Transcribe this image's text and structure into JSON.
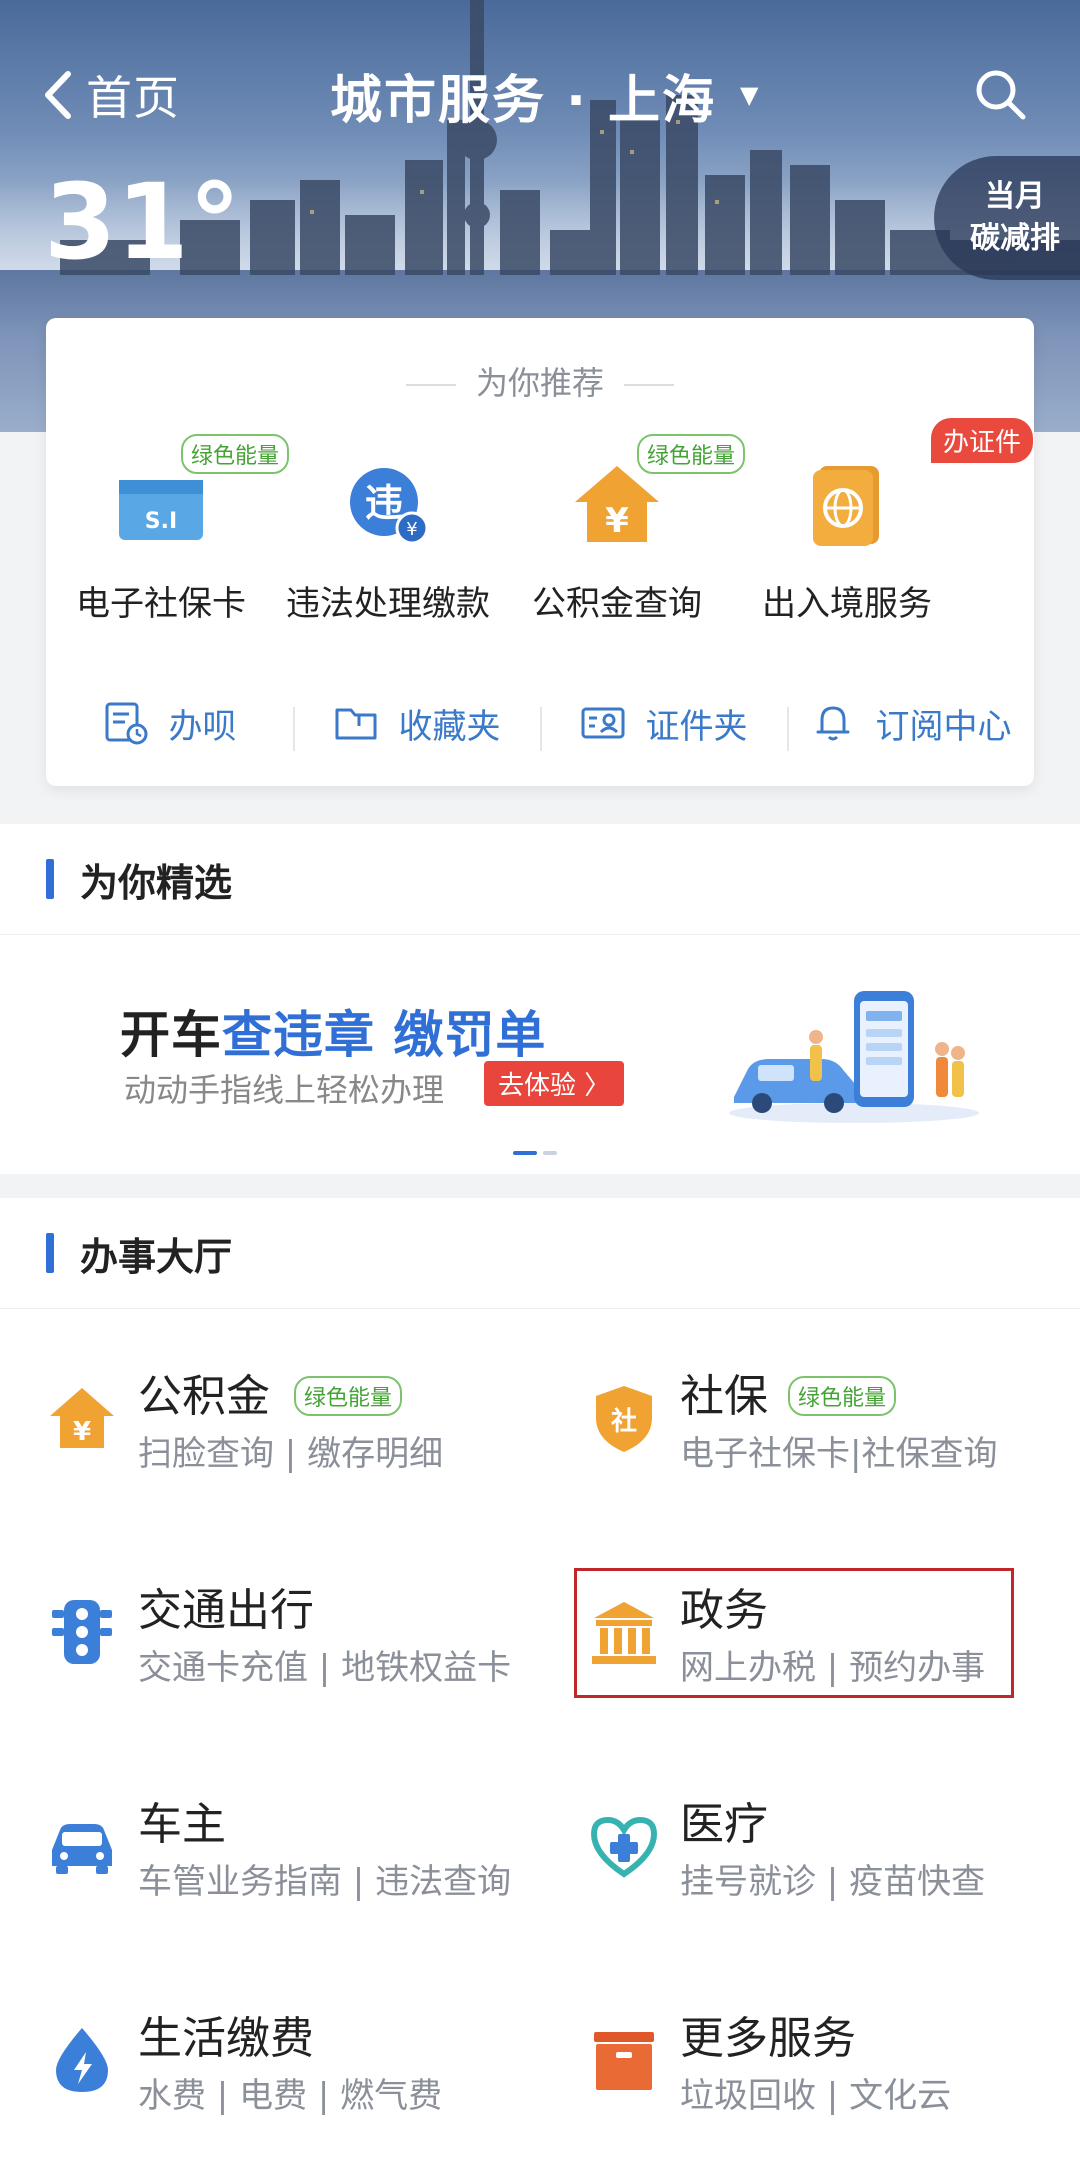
{
  "header": {
    "back_label": "首页",
    "title": "城市服务 · 上海",
    "title_caret": "▼",
    "temperature": "31°",
    "carbon_badge_line1": "当月",
    "carbon_badge_line2": "碳减排"
  },
  "recommend": {
    "title": "为你推荐",
    "items": [
      {
        "label": "电子社保卡",
        "tag": "绿色能量",
        "icon": "social-security-card-icon"
      },
      {
        "label": "违法处理缴款",
        "tag": "",
        "icon": "violation-payment-icon"
      },
      {
        "label": "公积金查询",
        "tag": "绿色能量",
        "icon": "housing-fund-icon"
      },
      {
        "label": "出入境服务",
        "tag": "办证件",
        "icon": "passport-icon"
      }
    ],
    "quick_links": [
      {
        "label": "办呗",
        "icon": "task-list-icon"
      },
      {
        "label": "收藏夹",
        "icon": "folder-icon"
      },
      {
        "label": "证件夹",
        "icon": "id-card-icon"
      },
      {
        "label": "订阅中心",
        "icon": "bell-icon"
      }
    ]
  },
  "featured": {
    "section_title": "为你精选",
    "banner": {
      "title_plain": "开车",
      "title_blue": "查违章 缴罚单",
      "subtitle": "动动手指线上轻松办理",
      "button": "去体验 〉"
    }
  },
  "hall": {
    "section_title": "办事大厅",
    "services": [
      {
        "name": "公积金",
        "tag": "绿色能量",
        "desc": "扫脸查询 | 缴存明细",
        "icon": "housing-fund-icon"
      },
      {
        "name": "社保",
        "tag": "绿色能量",
        "desc": "电子社保卡|社保查询",
        "icon": "social-security-shield-icon"
      },
      {
        "name": "交通出行",
        "tag": "",
        "desc": "交通卡充值 | 地铁权益卡",
        "icon": "traffic-light-icon"
      },
      {
        "name": "政务",
        "tag": "",
        "desc": "网上办税 | 预约办事",
        "icon": "government-building-icon"
      },
      {
        "name": "车主",
        "tag": "",
        "desc": "车管业务指南 | 违法查询",
        "icon": "car-icon"
      },
      {
        "name": "医疗",
        "tag": "",
        "desc": "挂号就诊 | 疫苗快查",
        "icon": "medical-heart-icon"
      },
      {
        "name": "生活缴费",
        "tag": "",
        "desc": "水费 | 电费 | 燃气费",
        "icon": "utility-drop-icon"
      },
      {
        "name": "更多服务",
        "tag": "",
        "desc": "垃圾回收 | 文化云",
        "icon": "more-services-box-icon"
      }
    ]
  },
  "colors": {
    "accent_blue": "#2f6fd6",
    "link_blue": "#3b7ac9",
    "tag_green": "#45a336",
    "tag_red": "#ea4a3e",
    "highlight_red": "#c0272d"
  }
}
